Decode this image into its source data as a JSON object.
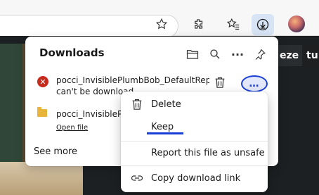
{
  "browser": {
    "toolbar_icons": [
      "star-icon",
      "extensions-icon",
      "favorites-icon",
      "downloads-icon",
      "avatar"
    ]
  },
  "page": {
    "tabs": [
      "eze",
      "tu"
    ]
  },
  "downloads": {
    "title": "Downloads",
    "header_icons": [
      "folder-icon",
      "search-icon",
      "more-icon",
      "pin-icon"
    ],
    "items": [
      {
        "name": "pocci_InvisiblePlumbBob_DefaultReplacer",
        "status": "can't be downloaded",
        "status_visible": "can't be download",
        "status_icon": "error-icon"
      },
      {
        "name": "pocci_InvisiblePlu",
        "action": "Open file",
        "status_icon": "file-icon"
      }
    ],
    "see_more": "See more",
    "more_button": "…"
  },
  "context_menu": {
    "items": [
      {
        "label": "Delete",
        "icon": "trash-icon"
      },
      {
        "label": "Keep",
        "icon": ""
      },
      {
        "label": "Report this file as unsafe",
        "icon": ""
      },
      {
        "label": "Copy download link",
        "icon": "link-icon"
      }
    ],
    "highlight_color": "#1a3fd6"
  }
}
